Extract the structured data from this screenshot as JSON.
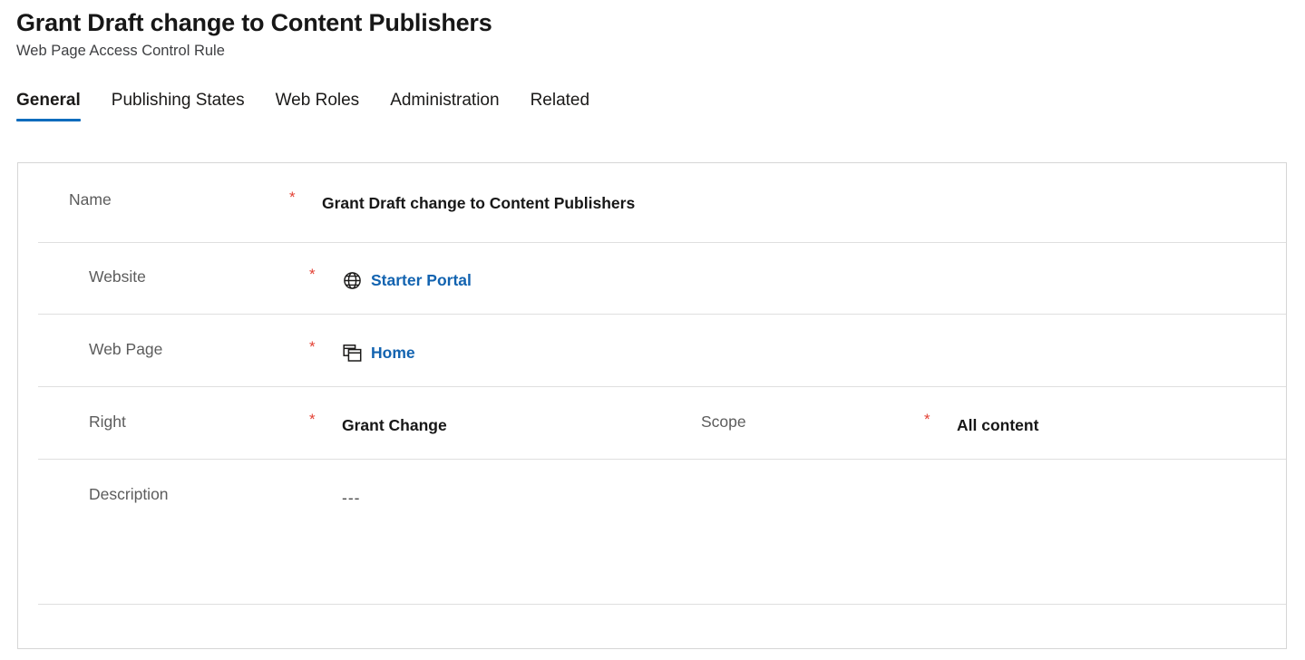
{
  "header": {
    "title": "Grant Draft change to Content Publishers",
    "subtitle": "Web Page Access Control Rule"
  },
  "tabs": [
    {
      "label": "General",
      "active": true
    },
    {
      "label": "Publishing States",
      "active": false
    },
    {
      "label": "Web Roles",
      "active": false
    },
    {
      "label": "Administration",
      "active": false
    },
    {
      "label": "Related",
      "active": false
    }
  ],
  "form": {
    "required_marker": "*",
    "fields": {
      "name": {
        "label": "Name",
        "value": "Grant Draft change to Content Publishers",
        "required": true
      },
      "website": {
        "label": "Website",
        "value": "Starter Portal",
        "icon": "globe-icon",
        "required": true
      },
      "web_page": {
        "label": "Web Page",
        "value": "Home",
        "icon": "web-pages-icon",
        "required": true
      },
      "right": {
        "label": "Right",
        "value": "Grant Change",
        "required": true
      },
      "scope": {
        "label": "Scope",
        "value": "All content",
        "required": true
      },
      "description": {
        "label": "Description",
        "value": "---",
        "required": false
      }
    }
  },
  "colors": {
    "accent": "#0f6cbd",
    "link": "#1263b0",
    "required": "#e34134",
    "label": "#5c5c5c",
    "value": "#171717",
    "border": "#d6d6d6",
    "divider": "#dfdfdf"
  }
}
